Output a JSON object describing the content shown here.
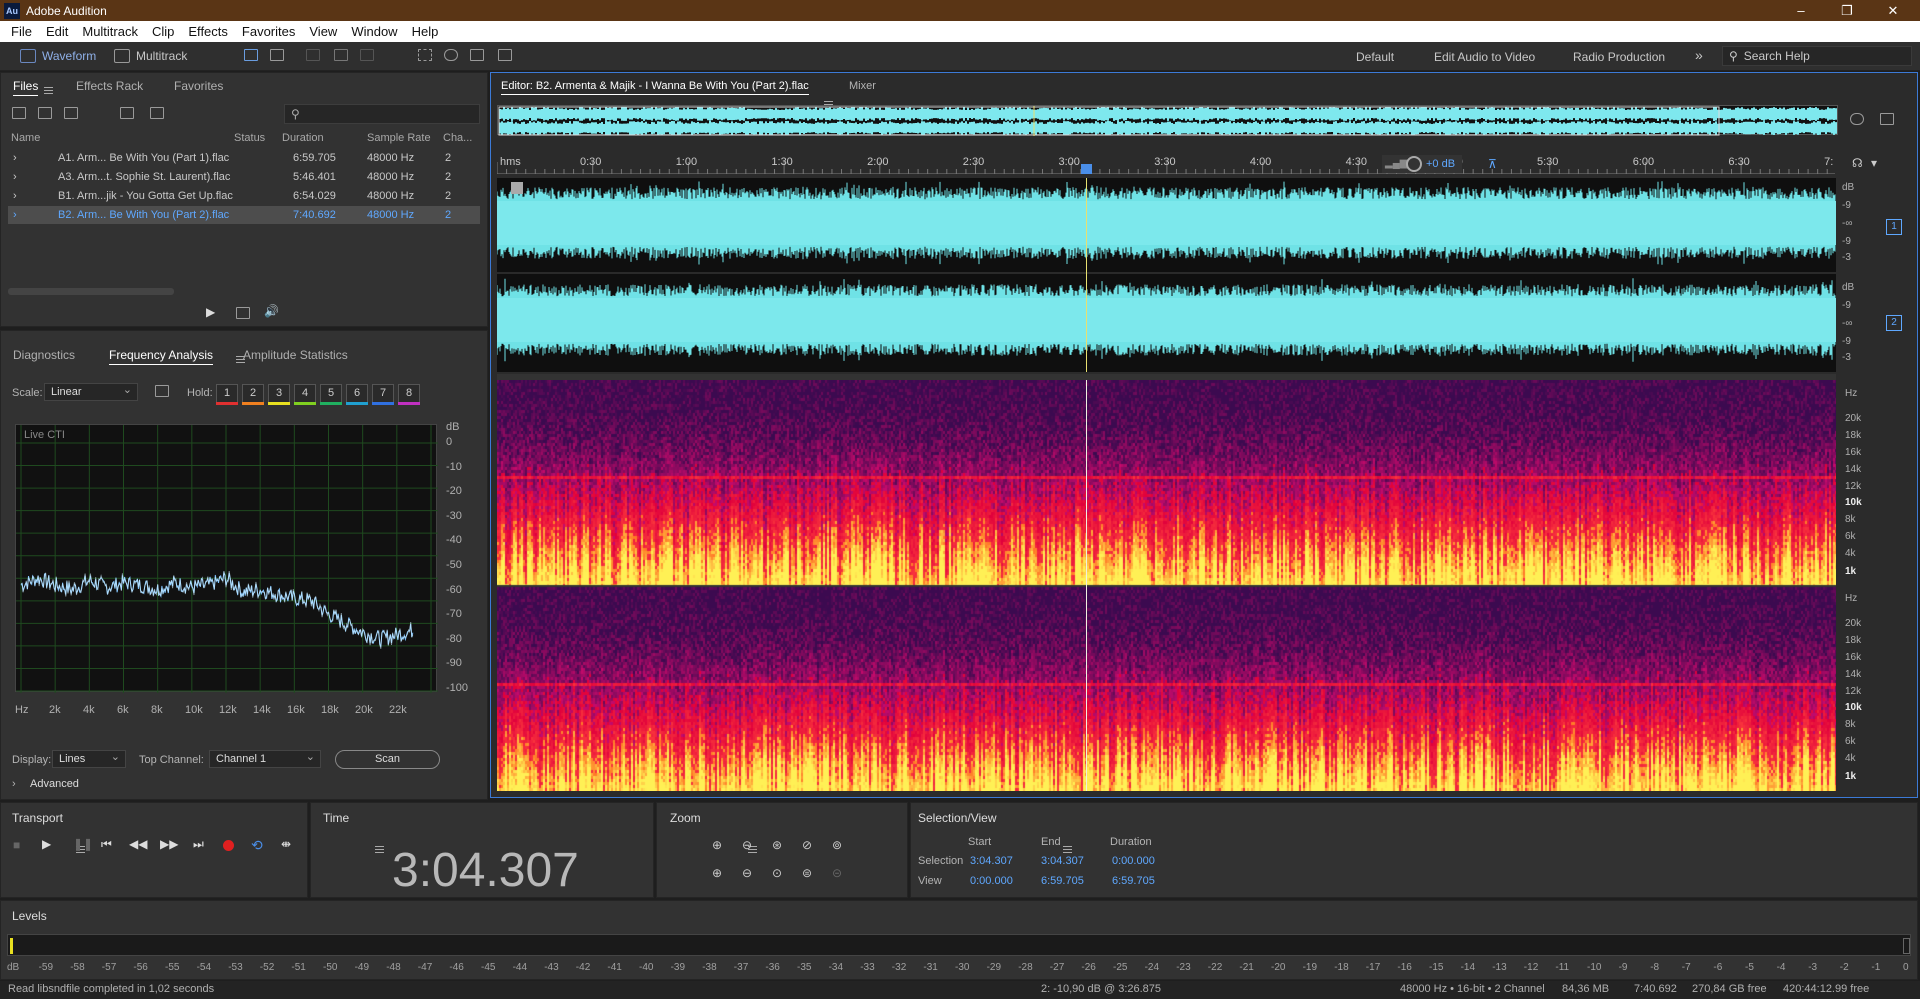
{
  "app": {
    "title": "Adobe Audition",
    "logo": "Au"
  },
  "window_controls": {
    "minimize": "–",
    "maximize": "❐",
    "close": "✕"
  },
  "menu": [
    "File",
    "Edit",
    "Multitrack",
    "Clip",
    "Effects",
    "Favorites",
    "View",
    "Window",
    "Help"
  ],
  "toolbar": {
    "waveform": "Waveform",
    "multitrack": "Multitrack",
    "workspaces": [
      "Default",
      "Edit Audio to Video",
      "Radio Production"
    ],
    "more": "»",
    "search_placeholder": "Search Help"
  },
  "files_panel": {
    "tabs": [
      "Files",
      "Effects Rack",
      "Favorites"
    ],
    "search_icon": "search-icon",
    "columns": [
      "Name",
      "Status",
      "Duration",
      "Sample Rate",
      "Cha..."
    ],
    "rows": [
      {
        "name": "A1. Arm... Be With You (Part 1).flac",
        "duration": "6:59.705",
        "rate": "48000 Hz",
        "ch": "2"
      },
      {
        "name": "A3. Arm...t. Sophie St. Laurent).flac",
        "duration": "5:46.401",
        "rate": "48000 Hz",
        "ch": "2"
      },
      {
        "name": "B1. Arm...jik - You Gotta Get Up.flac",
        "duration": "6:54.029",
        "rate": "48000 Hz",
        "ch": "2"
      },
      {
        "name": "B2. Arm... Be With You (Part 2).flac",
        "duration": "7:40.692",
        "rate": "48000 Hz",
        "ch": "2"
      }
    ]
  },
  "analysis_panel": {
    "tabs": [
      "Diagnostics",
      "Frequency Analysis",
      "Amplitude Statistics"
    ],
    "scale_label": "Scale:",
    "scale_value": "Linear",
    "hold_label": "Hold:",
    "holds": [
      "1",
      "2",
      "3",
      "4",
      "5",
      "6",
      "7",
      "8"
    ],
    "hold_colors": [
      "#e03030",
      "#f08020",
      "#e8e020",
      "#80d020",
      "#20b060",
      "#20a0d0",
      "#3070e0",
      "#c030c0"
    ],
    "graph_label": "Live CTI",
    "db_ticks": [
      "dB",
      "0",
      "-10",
      "-20",
      "-30",
      "-40",
      "-50",
      "-60",
      "-70",
      "-80",
      "-90",
      "-100"
    ],
    "hz_ticks": [
      "Hz",
      "2k",
      "4k",
      "6k",
      "8k",
      "10k",
      "12k",
      "14k",
      "16k",
      "18k",
      "20k",
      "22k"
    ],
    "display_label": "Display:",
    "display_value": "Lines",
    "top_channel_label": "Top Channel:",
    "top_channel_value": "Channel 1",
    "scan": "Scan",
    "advanced": "Advanced"
  },
  "editor": {
    "tab": "Editor: B2. Armenta & Majik - I Wanna Be With You (Part 2).flac",
    "mixer": "Mixer",
    "ruler_unit": "hms",
    "ruler": [
      "0:30",
      "1:00",
      "1:30",
      "2:00",
      "2:30",
      "3:00",
      "3:30",
      "4:00",
      "4:30",
      "5:00",
      "5:30",
      "6:00",
      "6:30",
      "7:"
    ],
    "hud": "+0 dB",
    "wave_db": [
      "dB",
      "-9",
      "-∞",
      "-9",
      "-3"
    ],
    "channels": [
      "1",
      "2"
    ],
    "spec_hz": [
      "Hz",
      "20k",
      "18k",
      "16k",
      "14k",
      "12k",
      "10k",
      "8k",
      "6k",
      "4k",
      "1k"
    ],
    "bold_ticks": [
      "10k",
      "1k"
    ]
  },
  "transport": {
    "title": "Transport"
  },
  "time": {
    "title": "Time",
    "value": "3:04.307"
  },
  "zoom": {
    "title": "Zoom"
  },
  "selection": {
    "title": "Selection/View",
    "cols": [
      "Start",
      "End",
      "Duration"
    ],
    "rows": [
      {
        "label": "Selection",
        "start": "3:04.307",
        "end": "3:04.307",
        "dur": "0:00.000"
      },
      {
        "label": "View",
        "start": "0:00.000",
        "end": "6:59.705",
        "dur": "6:59.705"
      }
    ]
  },
  "levels": {
    "title": "Levels",
    "scale": [
      "dB",
      "-59",
      "-58",
      "-57",
      "-56",
      "-55",
      "-54",
      "-53",
      "-52",
      "-51",
      "-50",
      "-49",
      "-48",
      "-47",
      "-46",
      "-45",
      "-44",
      "-43",
      "-42",
      "-41",
      "-40",
      "-39",
      "-38",
      "-37",
      "-36",
      "-35",
      "-34",
      "-33",
      "-32",
      "-31",
      "-30",
      "-29",
      "-28",
      "-27",
      "-26",
      "-25",
      "-24",
      "-23",
      "-22",
      "-21",
      "-20",
      "-19",
      "-18",
      "-17",
      "-16",
      "-15",
      "-14",
      "-13",
      "-12",
      "-11",
      "-10",
      "-9",
      "-8",
      "-7",
      "-6",
      "-5",
      "-4",
      "-3",
      "-2",
      "-1",
      "0"
    ]
  },
  "status": {
    "left": "Read libsndfile completed in 1,02 seconds",
    "cursor": "2: -10,90 dB @ 3:26.875",
    "format": "48000 Hz • 16-bit • 2 Channel",
    "mem": "84,36 MB",
    "dur": "7:40.692",
    "free": "270,84 GB free",
    "time_free": "420:44:12.99 free"
  },
  "chart_data": {
    "type": "line",
    "title": "Live CTI",
    "xlabel": "Hz",
    "ylabel": "dB",
    "xlim": [
      0,
      24000
    ],
    "ylim": [
      -100,
      10
    ],
    "series": [
      {
        "x": [
          0,
          1000,
          2000,
          3000,
          4000,
          5000,
          6000,
          7000,
          8000,
          9000,
          10000,
          11000,
          12000,
          13000,
          14000,
          15000,
          16000,
          17000,
          18000,
          19000,
          20000,
          21000,
          22000,
          23000
        ],
        "values": [
          -53,
          -50,
          -53,
          -55,
          -51,
          -54,
          -52,
          -53,
          -55,
          -52,
          -54,
          -53,
          -50,
          -56,
          -55,
          -57,
          -59,
          -60,
          -66,
          -70,
          -74,
          -77,
          -75,
          -73
        ]
      }
    ]
  }
}
